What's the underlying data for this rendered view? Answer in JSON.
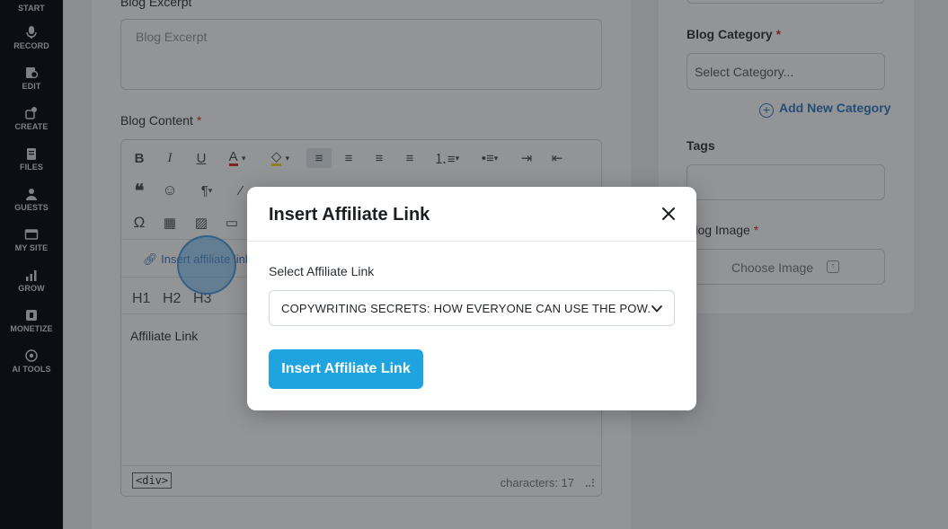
{
  "sidebar": {
    "items": [
      {
        "label": "START",
        "icon": "start-icon"
      },
      {
        "label": "RECORD",
        "icon": "microphone-icon"
      },
      {
        "label": "EDIT",
        "icon": "edit-icon"
      },
      {
        "label": "CREATE",
        "icon": "create-icon"
      },
      {
        "label": "FILES",
        "icon": "files-icon"
      },
      {
        "label": "GUESTS",
        "icon": "guests-icon"
      },
      {
        "label": "MY SITE",
        "icon": "site-icon"
      },
      {
        "label": "GROW",
        "icon": "chart-icon"
      },
      {
        "label": "MONETIZE",
        "icon": "monetize-icon"
      },
      {
        "label": "AI TOOLS",
        "icon": "ai-icon"
      }
    ]
  },
  "form": {
    "excerpt_label": "Blog Excerpt",
    "excerpt_placeholder": "Blog Excerpt",
    "content_label": "Blog Content",
    "required_mark": "*",
    "editor": {
      "affiliate_link_button": "Insert affiliate link",
      "h1": "H1",
      "h2": "H2",
      "h3": "H3",
      "text": "Affiliate Link",
      "path_tag": "<div>",
      "char_count": "characters: 17"
    }
  },
  "right_panel": {
    "category_label": "Blog Category",
    "category_placeholder": "Select Category...",
    "add_category": "Add New Category",
    "tags_label": "Tags",
    "image_label": "Blog Image",
    "choose_image": "Choose Image"
  },
  "modal": {
    "title": "Insert Affiliate Link",
    "select_label": "Select Affiliate Link",
    "selected_value": "COPYWRITING SECRETS: HOW EVERYONE CAN USE THE POW...",
    "button_label": "Insert Affiliate Link"
  },
  "colors": {
    "accent": "#1fa4e0",
    "link": "#1f6fc5",
    "sidebar_bg": "#0b0f14",
    "required": "#d21d1d"
  }
}
